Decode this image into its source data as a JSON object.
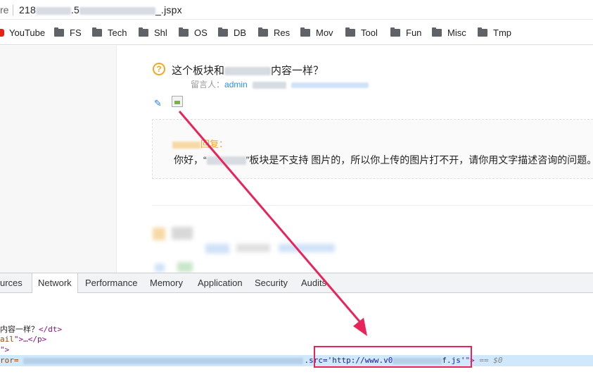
{
  "urlbar": {
    "security_fragment": "re",
    "url_prefix": "218",
    "url_mid": ".5",
    "url_suffix": "_.jspx"
  },
  "bookmarks": [
    {
      "label": "YouTube",
      "icon": "youtube-icon"
    },
    {
      "label": "FS",
      "icon": "folder-icon"
    },
    {
      "label": "Tech",
      "icon": "folder-icon"
    },
    {
      "label": "Shl",
      "icon": "folder-icon"
    },
    {
      "label": "OS",
      "icon": "folder-icon"
    },
    {
      "label": "DB",
      "icon": "folder-icon"
    },
    {
      "label": "Res",
      "icon": "folder-icon"
    },
    {
      "label": "Mov",
      "icon": "folder-icon"
    },
    {
      "label": "Tool",
      "icon": "folder-icon"
    },
    {
      "label": "Fun",
      "icon": "folder-icon"
    },
    {
      "label": "Misc",
      "icon": "folder-icon"
    },
    {
      "label": "Tmp",
      "icon": "folder-icon"
    }
  ],
  "question": {
    "title_start": "这个板块和",
    "title_end": "内容一样？",
    "poster_label": "留言人：",
    "poster_name": "admin"
  },
  "reply": {
    "header": "回复：",
    "text_start": "你好，“",
    "text_end": "”板块是不支持 图片的，所以你上传的图片打不开，请你用文字描述咨询的问题。"
  },
  "devtools": {
    "tabs": [
      "urces",
      "Network",
      "Performance",
      "Memory",
      "Application",
      "Security",
      "Audits"
    ],
    "active_tab": "Network",
    "lines": {
      "line1_text": "内容一样？",
      "line1_close": "</dt>",
      "line2_attr": "ail",
      "line2_rest": "\">…</p>",
      "line3": "\">",
      "line4_attr": "ror=",
      "src_attr": ".src=",
      "src_val_start": "'http://www.v0",
      "src_val_end": "f.js'",
      "tail": "\">",
      "eq": " == $0"
    }
  },
  "colors": {
    "annotation": "#e8245a",
    "link_blue": "#2d8cf0",
    "reply_orange": "#f5a623"
  }
}
